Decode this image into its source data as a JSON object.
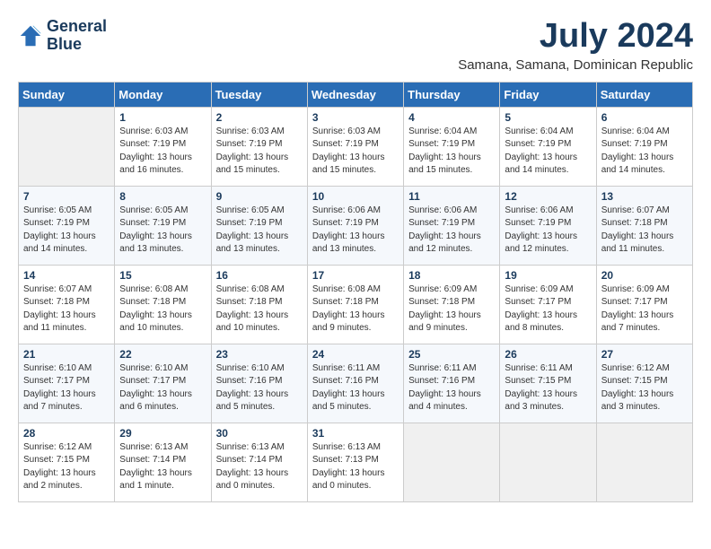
{
  "logo": {
    "line1": "General",
    "line2": "Blue"
  },
  "title": "July 2024",
  "subtitle": "Samana, Samana, Dominican Republic",
  "days_header": [
    "Sunday",
    "Monday",
    "Tuesday",
    "Wednesday",
    "Thursday",
    "Friday",
    "Saturday"
  ],
  "weeks": [
    [
      {
        "day": "",
        "info": ""
      },
      {
        "day": "1",
        "info": "Sunrise: 6:03 AM\nSunset: 7:19 PM\nDaylight: 13 hours\nand 16 minutes."
      },
      {
        "day": "2",
        "info": "Sunrise: 6:03 AM\nSunset: 7:19 PM\nDaylight: 13 hours\nand 15 minutes."
      },
      {
        "day": "3",
        "info": "Sunrise: 6:03 AM\nSunset: 7:19 PM\nDaylight: 13 hours\nand 15 minutes."
      },
      {
        "day": "4",
        "info": "Sunrise: 6:04 AM\nSunset: 7:19 PM\nDaylight: 13 hours\nand 15 minutes."
      },
      {
        "day": "5",
        "info": "Sunrise: 6:04 AM\nSunset: 7:19 PM\nDaylight: 13 hours\nand 14 minutes."
      },
      {
        "day": "6",
        "info": "Sunrise: 6:04 AM\nSunset: 7:19 PM\nDaylight: 13 hours\nand 14 minutes."
      }
    ],
    [
      {
        "day": "7",
        "info": "Sunrise: 6:05 AM\nSunset: 7:19 PM\nDaylight: 13 hours\nand 14 minutes."
      },
      {
        "day": "8",
        "info": "Sunrise: 6:05 AM\nSunset: 7:19 PM\nDaylight: 13 hours\nand 13 minutes."
      },
      {
        "day": "9",
        "info": "Sunrise: 6:05 AM\nSunset: 7:19 PM\nDaylight: 13 hours\nand 13 minutes."
      },
      {
        "day": "10",
        "info": "Sunrise: 6:06 AM\nSunset: 7:19 PM\nDaylight: 13 hours\nand 13 minutes."
      },
      {
        "day": "11",
        "info": "Sunrise: 6:06 AM\nSunset: 7:19 PM\nDaylight: 13 hours\nand 12 minutes."
      },
      {
        "day": "12",
        "info": "Sunrise: 6:06 AM\nSunset: 7:19 PM\nDaylight: 13 hours\nand 12 minutes."
      },
      {
        "day": "13",
        "info": "Sunrise: 6:07 AM\nSunset: 7:18 PM\nDaylight: 13 hours\nand 11 minutes."
      }
    ],
    [
      {
        "day": "14",
        "info": "Sunrise: 6:07 AM\nSunset: 7:18 PM\nDaylight: 13 hours\nand 11 minutes."
      },
      {
        "day": "15",
        "info": "Sunrise: 6:08 AM\nSunset: 7:18 PM\nDaylight: 13 hours\nand 10 minutes."
      },
      {
        "day": "16",
        "info": "Sunrise: 6:08 AM\nSunset: 7:18 PM\nDaylight: 13 hours\nand 10 minutes."
      },
      {
        "day": "17",
        "info": "Sunrise: 6:08 AM\nSunset: 7:18 PM\nDaylight: 13 hours\nand 9 minutes."
      },
      {
        "day": "18",
        "info": "Sunrise: 6:09 AM\nSunset: 7:18 PM\nDaylight: 13 hours\nand 9 minutes."
      },
      {
        "day": "19",
        "info": "Sunrise: 6:09 AM\nSunset: 7:17 PM\nDaylight: 13 hours\nand 8 minutes."
      },
      {
        "day": "20",
        "info": "Sunrise: 6:09 AM\nSunset: 7:17 PM\nDaylight: 13 hours\nand 7 minutes."
      }
    ],
    [
      {
        "day": "21",
        "info": "Sunrise: 6:10 AM\nSunset: 7:17 PM\nDaylight: 13 hours\nand 7 minutes."
      },
      {
        "day": "22",
        "info": "Sunrise: 6:10 AM\nSunset: 7:17 PM\nDaylight: 13 hours\nand 6 minutes."
      },
      {
        "day": "23",
        "info": "Sunrise: 6:10 AM\nSunset: 7:16 PM\nDaylight: 13 hours\nand 5 minutes."
      },
      {
        "day": "24",
        "info": "Sunrise: 6:11 AM\nSunset: 7:16 PM\nDaylight: 13 hours\nand 5 minutes."
      },
      {
        "day": "25",
        "info": "Sunrise: 6:11 AM\nSunset: 7:16 PM\nDaylight: 13 hours\nand 4 minutes."
      },
      {
        "day": "26",
        "info": "Sunrise: 6:11 AM\nSunset: 7:15 PM\nDaylight: 13 hours\nand 3 minutes."
      },
      {
        "day": "27",
        "info": "Sunrise: 6:12 AM\nSunset: 7:15 PM\nDaylight: 13 hours\nand 3 minutes."
      }
    ],
    [
      {
        "day": "28",
        "info": "Sunrise: 6:12 AM\nSunset: 7:15 PM\nDaylight: 13 hours\nand 2 minutes."
      },
      {
        "day": "29",
        "info": "Sunrise: 6:13 AM\nSunset: 7:14 PM\nDaylight: 13 hours\nand 1 minute."
      },
      {
        "day": "30",
        "info": "Sunrise: 6:13 AM\nSunset: 7:14 PM\nDaylight: 13 hours\nand 0 minutes."
      },
      {
        "day": "31",
        "info": "Sunrise: 6:13 AM\nSunset: 7:13 PM\nDaylight: 13 hours\nand 0 minutes."
      },
      {
        "day": "",
        "info": ""
      },
      {
        "day": "",
        "info": ""
      },
      {
        "day": "",
        "info": ""
      }
    ]
  ]
}
